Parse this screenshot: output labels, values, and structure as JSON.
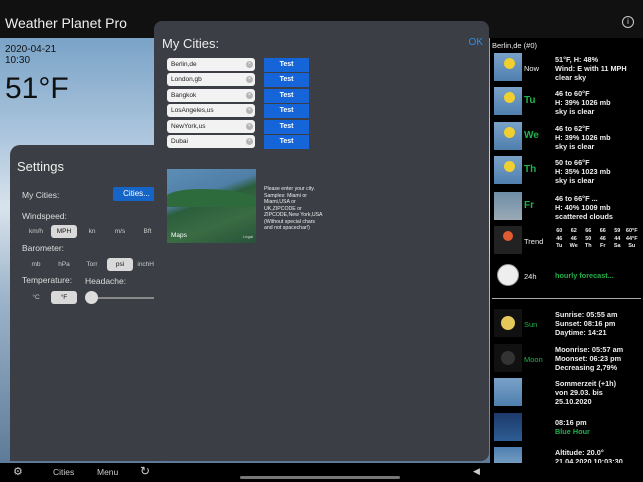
{
  "app": {
    "title": "Weather Planet Pro",
    "info_icon": "info-icon"
  },
  "background": {
    "date": "2020-04-21",
    "time": "10:30",
    "temperature": "51°F"
  },
  "settings": {
    "title": "Settings",
    "my_cities_label": "My Cities:",
    "cities_button": "Cities...",
    "windspeed_label": "Windspeed:",
    "windspeed_options": [
      "km/h",
      "MPH",
      "kn",
      "m/s",
      "Bft"
    ],
    "windspeed_selected": "MPH",
    "barometer_label": "Barometer:",
    "barometer_options": [
      "mb",
      "hPa",
      "Torr",
      "psi",
      "inchHg"
    ],
    "barometer_selected": "psi",
    "temperature_label": "Temperature:",
    "temperature_options": [
      "°C",
      "°F"
    ],
    "temperature_selected": "°F",
    "headache_label": "Headache:",
    "headache_value": 0
  },
  "popup": {
    "title": "My Cities:",
    "ok_label": "OK",
    "cities": [
      {
        "value": "Berlin,de",
        "button": "Test"
      },
      {
        "value": "London,gb",
        "button": "Test"
      },
      {
        "value": "Bangkok",
        "button": "Test"
      },
      {
        "value": "LosAngeles,us",
        "button": "Test"
      },
      {
        "value": "NewYork,us",
        "button": "Test"
      },
      {
        "value": "Dubai",
        "button": "Test"
      }
    ],
    "map_logo": "Maps",
    "map_legal": "Legal",
    "hint": "Please enter your city.\nSamples: Miami or\nMiami,USA or\nUK,ZIPCODE or\nZIPCODE,New York,USA\n(Without special chars\nand not spacechar!)"
  },
  "forecast": {
    "header": "Berlin,de (#0)",
    "rows": [
      {
        "label": "Now",
        "icon": "sun-icon",
        "text": "51°F, H: 48%\nWind: E with 11 MPH\nclear sky"
      },
      {
        "label": "Tu",
        "icon": "sun-icon",
        "text": "46 to 60°F\nH: 39% 1026 mb\nsky is clear"
      },
      {
        "label": "We",
        "icon": "sun-icon",
        "text": "46 to 62°F\nH: 39% 1026 mb\nsky is clear"
      },
      {
        "label": "Th",
        "icon": "sun-icon",
        "text": "50 to 66°F\nH: 35% 1023 mb\nsky is clear"
      },
      {
        "label": "Fr",
        "icon": "cloud-icon",
        "text": "46 to 66°F ...\nH: 40% 1009 mb\nscattered clouds"
      }
    ],
    "trend": {
      "label": "Trend",
      "highs": [
        "60",
        "62",
        "66",
        "66",
        "59",
        "60°F"
      ],
      "lows": [
        "46",
        "46",
        "50",
        "46",
        "44",
        "44°F"
      ],
      "days": [
        "Tu",
        "We",
        "Th",
        "Fr",
        "Sa",
        "Su"
      ]
    },
    "hourly": {
      "label": "24h",
      "text": "hourly forecast..."
    },
    "sun": {
      "label": "Sun",
      "text": "Sunrise: 05:55 am\nSunset: 08:16 pm\nDaytime: 14:21"
    },
    "moon": {
      "label": "Moon",
      "text": "Moonrise: 05:57 am\nMoonset: 06:23 pm\nDecreasing 2,79%"
    },
    "dst": {
      "text": "Sommerzeit (+1h)\nvon 29.03. bis\n25.10.2020"
    },
    "blue_hour": {
      "time": "08:16 pm",
      "label": "Blue Hour"
    },
    "altitude": {
      "text": "Altitude: 20.0°\n21.04.2020 10:03:30"
    }
  },
  "tabbar": {
    "cities": "Cities",
    "menu": "Menu"
  }
}
